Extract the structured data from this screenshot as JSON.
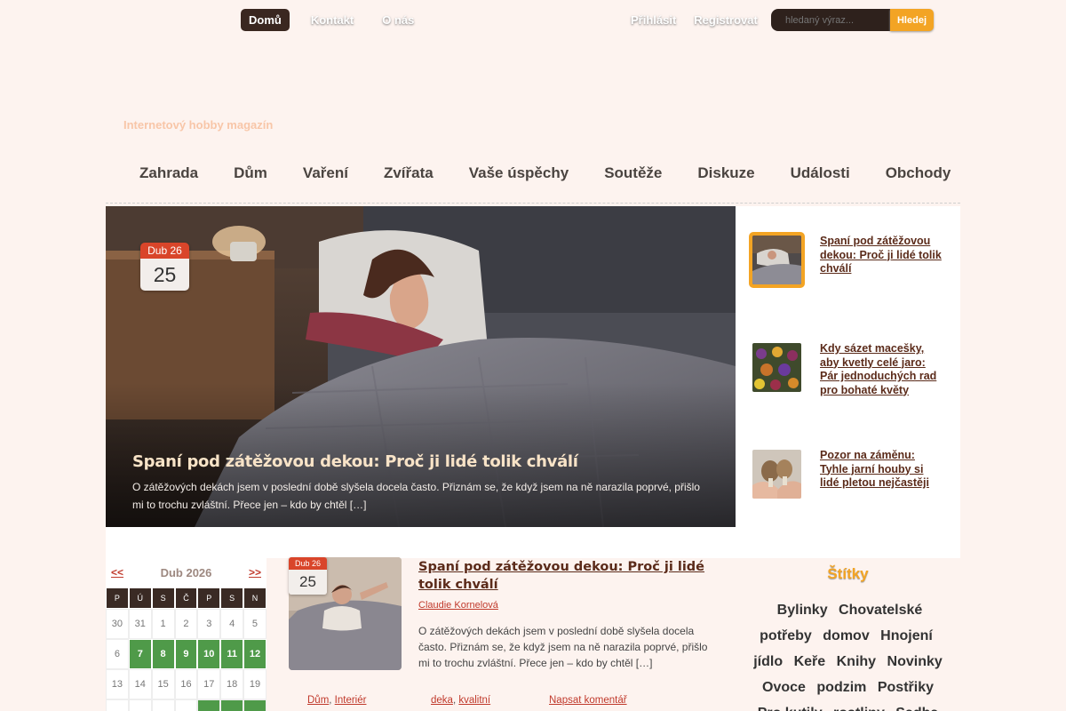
{
  "top_nav": [
    {
      "label": "Domů",
      "active": true
    },
    {
      "label": "Kontakt",
      "active": false
    },
    {
      "label": "O nás",
      "active": false
    }
  ],
  "user_nav": [
    {
      "label": "Přihlásit"
    },
    {
      "label": "Registrovat"
    }
  ],
  "search": {
    "placeholder": "hledaný výraz...",
    "button": "Hledej"
  },
  "tagline": "Internetový hobby magazín",
  "main_menu": [
    "Zahrada",
    "Dům",
    "Vaření",
    "Zvířata",
    "Vaše úspěchy",
    "Soutěže",
    "Diskuze",
    "Události",
    "Obchody"
  ],
  "hero": {
    "date_month": "Dub 26",
    "date_day": "25",
    "title": "Spaní pod zátěžovou dekou: Proč ji lidé tolik chválí",
    "excerpt": "O zátěžových dekách jsem v poslední době slyšela docela často. Přiznám se, že když jsem na ně narazila poprvé, přišlo mi to trochu zvláštní. Přece jen – kdo by chtěl […]"
  },
  "featured": [
    {
      "title": "Spaní pod zátěžovou dekou: Proč ji lidé tolik chválí",
      "icon": "sleeping-woman-thumb",
      "active": true
    },
    {
      "title": "Kdy sázet macešky, aby kvetly celé jaro: Pár jednoduchých rad pro bohaté květy",
      "icon": "pansies-thumb",
      "active": false
    },
    {
      "title": "Pozor na záměnu: Tyhle jarní houby si lidé pletou nejčastěji",
      "icon": "mushrooms-thumb",
      "active": false
    }
  ],
  "calendar": {
    "prev": "<<",
    "next": ">>",
    "month": "Dub 2026",
    "dows": [
      "P",
      "Ú",
      "S",
      "Č",
      "P",
      "S",
      "N"
    ],
    "rows": [
      [
        {
          "d": "30"
        },
        {
          "d": "31"
        },
        {
          "d": "1"
        },
        {
          "d": "2"
        },
        {
          "d": "3"
        },
        {
          "d": "4"
        },
        {
          "d": "5"
        }
      ],
      [
        {
          "d": "6"
        },
        {
          "d": "7",
          "link": true
        },
        {
          "d": "8",
          "link": true
        },
        {
          "d": "9",
          "link": true
        },
        {
          "d": "10",
          "link": true
        },
        {
          "d": "11",
          "link": true
        },
        {
          "d": "12",
          "link": true
        }
      ],
      [
        {
          "d": "13"
        },
        {
          "d": "14"
        },
        {
          "d": "15"
        },
        {
          "d": "16"
        },
        {
          "d": "17"
        },
        {
          "d": "18"
        },
        {
          "d": "19"
        }
      ],
      [
        {
          "d": ""
        },
        {
          "d": ""
        },
        {
          "d": ""
        },
        {
          "d": ""
        },
        {
          "d": "",
          "hl": true
        },
        {
          "d": "",
          "hl": true
        },
        {
          "d": "",
          "hl": true
        }
      ]
    ]
  },
  "post": {
    "date_month": "Dub 26",
    "date_day": "25",
    "title": "Spaní pod zátěžovou dekou: Proč ji lidé tolik chválí",
    "author": "Claudie Kornelová",
    "excerpt": "O zátěžových dekách jsem v poslední době slyšela docela často. Přiznám se, že když jsem na ně narazila poprvé, přišlo mi to trochu zvláštní. Přece jen – kdo by chtěl […]",
    "categories": [
      "Dům",
      "Interiér"
    ],
    "tags": [
      "deka",
      "kvalitní"
    ],
    "comment": "Napsat komentář"
  },
  "tags_widget": {
    "title": "Štítky",
    "tags": [
      "Bylinky",
      "Chovatelské potřeby",
      "domov",
      "Hnojení",
      "jídlo",
      "Keře",
      "Knihy",
      "Novinky",
      "Ovoce",
      "podzim",
      "Postřiky",
      "Pro kutily",
      "rostliny",
      "Sadba"
    ]
  },
  "colors": {
    "accent": "#f3a424",
    "dark": "#3a2720",
    "link": "#c0392b",
    "calendar_green": "#4f9a49"
  }
}
